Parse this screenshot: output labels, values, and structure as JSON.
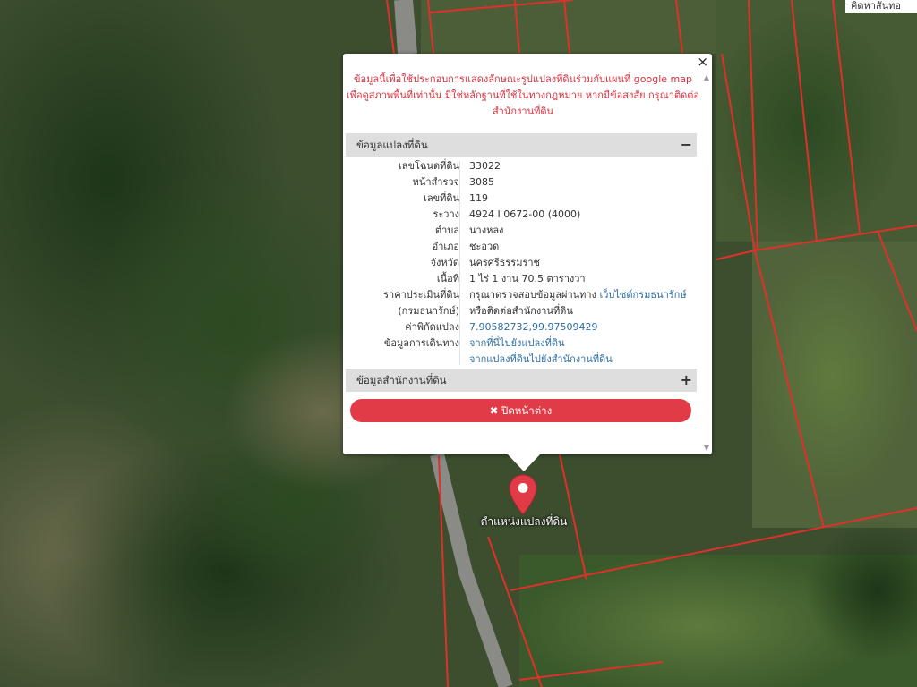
{
  "map": {
    "corner_label": "คิดหาสันทอ",
    "marker_label": "ตำแหน่งแปลงที่ดิน",
    "colors": {
      "parcel_line": "#e0302a",
      "road": "#8a8a86"
    }
  },
  "popup": {
    "close_symbol": "×",
    "disclaimer": "ข้อมูลนี้เพื่อใช้ประกอบการแสดงลักษณะรูปแปลงที่ดินร่วมกับแผนที่ google map เพื่อดูสภาพพื้นที่เท่านั้น มิใช่หลักฐานที่ใช้ในทางกฎหมาย หากมีข้อสงสัย กรุณาติดต่อสำนักงานที่ดิน",
    "section_land": {
      "title": "ข้อมูลแปลงที่ดิน",
      "toggle": "−"
    },
    "rows": [
      {
        "label": "เลขโฉนดที่ดิน",
        "value": "33022"
      },
      {
        "label": "หน้าสำรวจ",
        "value": "3085"
      },
      {
        "label": "เลขที่ดิน",
        "value": "119"
      },
      {
        "label": "ระวาง",
        "value": "4924 I 0672-00 (4000)"
      },
      {
        "label": "ตำบล",
        "value": "นางหลง"
      },
      {
        "label": "อำเภอ",
        "value": "ชะอวด"
      },
      {
        "label": "จังหวัด",
        "value": "นครศรีธรรมราช"
      },
      {
        "label": "เนื้อที่",
        "value": "1 ไร่ 1 งาน 70.5 ตารางวา"
      }
    ],
    "price": {
      "label1": "ราคาประเมินที่ดิน",
      "label2": "(กรมธนารักษ์)",
      "value_prefix": "กรุณาตรวจสอบข้อมูลผ่านทาง ",
      "link": "เว็บไซต์กรมธนารักษ์",
      "value_line2": "หรือติดต่อสำนักงานที่ดิน"
    },
    "coords": {
      "label": "ค่าพิกัดแปลง",
      "value": "7.90582732,99.97509429"
    },
    "travel": {
      "label": "ข้อมูลการเดินทาง",
      "link1": "จากที่นี่ไปยังแปลงที่ดิน",
      "link2": "จากแปลงที่ดินไปยังสำนักงานที่ดิน"
    },
    "section_office": {
      "title": "ข้อมูลสำนักงานที่ดิน",
      "toggle": "+"
    },
    "close_button": "✖ ปิดหน้าต่าง",
    "accent_color": "#e23b48"
  }
}
